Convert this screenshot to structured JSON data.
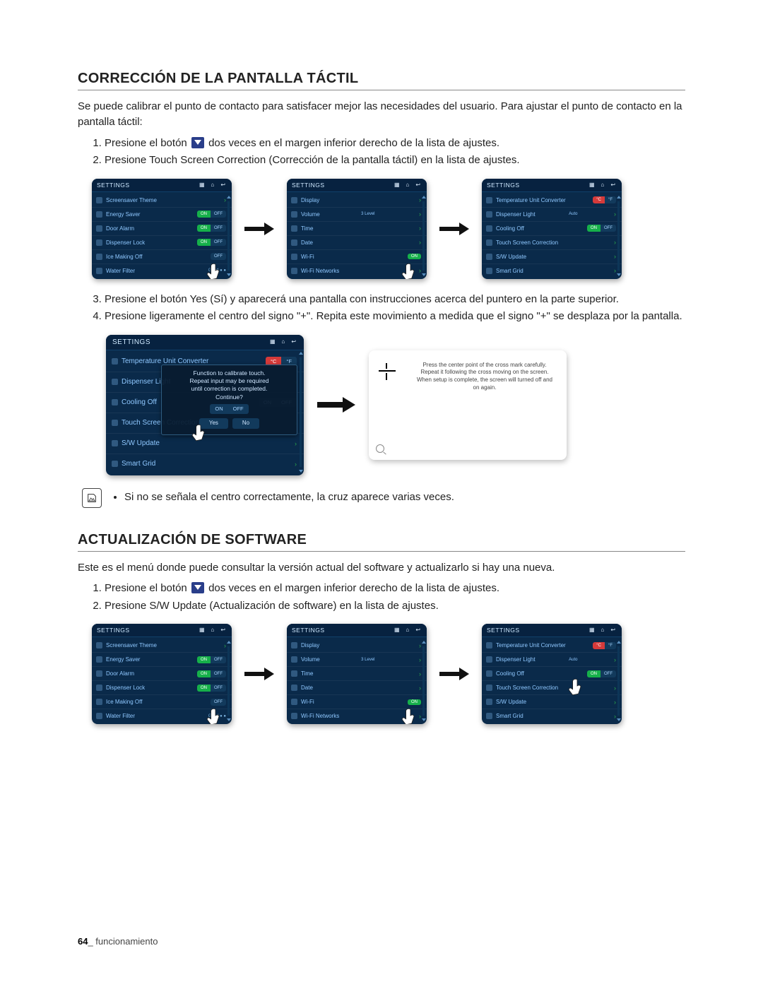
{
  "section1": {
    "title": "CORRECCIÓN DE LA PANTALLA TÁCTIL",
    "intro": "Se puede calibrar el punto de contacto para satisfacer mejor las necesidades del usuario. Para ajustar el punto de contacto en la pantalla táctil:",
    "step1_a": "Presione el botón ",
    "step1_b": " dos veces en el margen inferior derecho de la lista de ajustes.",
    "step2": "Presione Touch Screen Correction (Corrección de la pantalla táctil) en la lista de ajustes.",
    "step3": "Presione el botón Yes (Sí) y aparecerá una pantalla con instrucciones acerca del puntero en la parte superior.",
    "step4": "Presione ligeramente el centro del signo \"+\". Repita este movimiento a medida que el signo \"+\" se desplaza por la pantalla.",
    "note": "Si no se señala el centro correctamente, la cruz aparece varias veces."
  },
  "section2": {
    "title": "ACTUALIZACIÓN DE SOFTWARE",
    "intro": "Este es el menú donde puede consultar la versión actual del software y actualizarlo si hay una nueva.",
    "step1_a": "Presione el botón ",
    "step1_b": " dos veces en el margen inferior derecho de la lista de ajustes.",
    "step2": "Presione S/W Update (Actualización de software) en la lista de ajustes."
  },
  "settingsHeader": "SETTINGS",
  "panelA": {
    "i1": "Screensaver Theme",
    "i2": "Energy Saver",
    "i3": "Door Alarm",
    "i4": "Dispenser Lock",
    "i5": "Ice Making Off",
    "i6": "Water Filter"
  },
  "panelB": {
    "i1": "Display",
    "i2": "Volume",
    "i3": "Time",
    "i4": "Date",
    "i5": "Wi-Fi",
    "i6": "Wi-Fi Networks",
    "volLevel": "3 Level"
  },
  "panelC": {
    "i1": "Temperature Unit Converter",
    "i2": "Dispenser Light",
    "i3": "Cooling Off",
    "i4": "Touch Screen Correction",
    "i5": "S/W Update",
    "i6": "Smart Grid",
    "auto": "Auto"
  },
  "toggles": {
    "on": "ON",
    "off": "OFF",
    "c": "°C",
    "f": "°F"
  },
  "dialog": {
    "line1": "Function to calibrate touch.",
    "line2": "Repeat input may be required",
    "line3": "until correction is completed.",
    "line4": "Continue?",
    "yes": "Yes",
    "no": "No"
  },
  "calib": {
    "l1": "Press the center point of the cross mark carefully.",
    "l2": "Repeat it following the cross moving on the screen.",
    "l3": "When setup is complete, the screen will turned off and on again."
  },
  "footer": {
    "page": "64",
    "label": "_ funcionamiento"
  }
}
